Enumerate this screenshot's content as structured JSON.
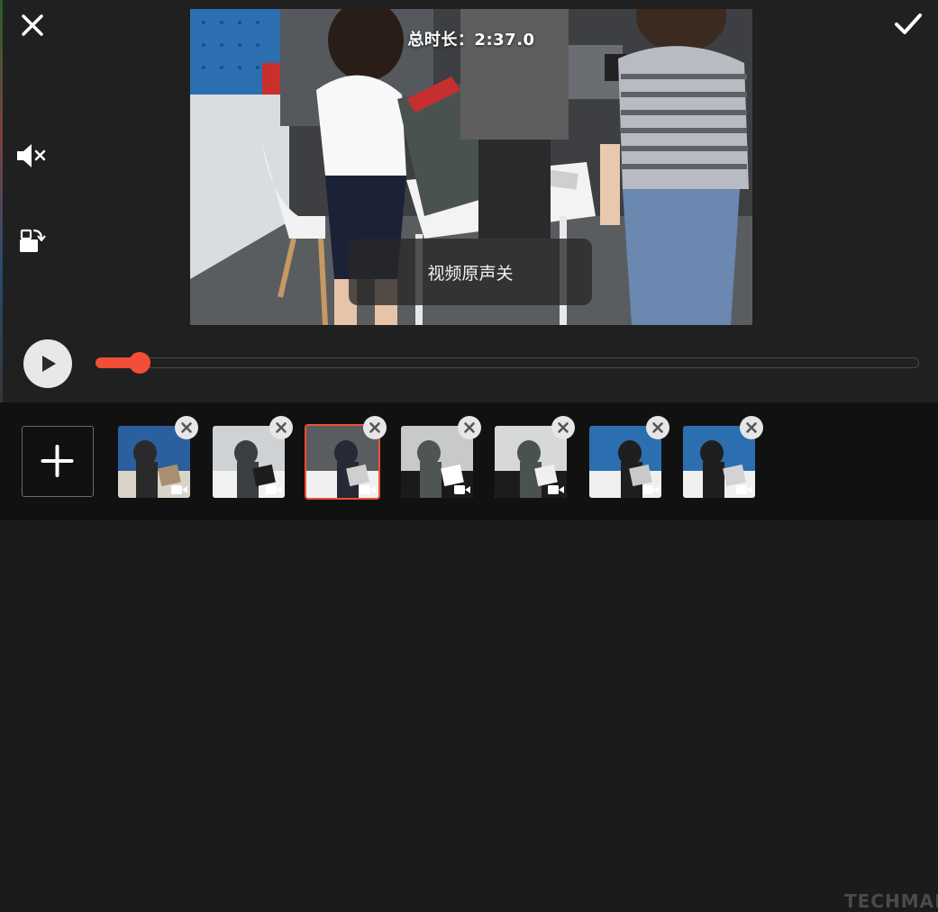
{
  "toolbar": {
    "close_icon": "close-icon",
    "confirm_icon": "checkmark-icon",
    "mute_icon": "speaker-muted-icon",
    "rotate_icon": "rotate-icon"
  },
  "preview": {
    "duration_text": "总时长：2:37.0",
    "toast_text": "视频原声关"
  },
  "playback": {
    "play_icon": "play-icon",
    "progress_fraction": 0.054,
    "accent_color": "#f04e37"
  },
  "clips": {
    "add_icon": "plus-icon",
    "items": [
      {
        "selected": false
      },
      {
        "selected": false
      },
      {
        "selected": true
      },
      {
        "selected": false
      },
      {
        "selected": false
      },
      {
        "selected": false
      },
      {
        "selected": false
      }
    ],
    "remove_icon": "close-circle-icon",
    "type_icon": "video-camera-icon"
  },
  "watermark": "TECHMAN"
}
